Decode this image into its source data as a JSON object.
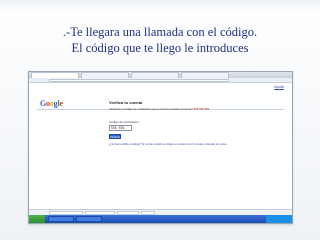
{
  "slide": {
    "caption_line1": ".-Te llegara una llamada con el código.",
    "caption_line2": "El código que te llego le introduces"
  },
  "screenshot": {
    "logo": {
      "g1": "G",
      "o1": "o",
      "o2": "o",
      "g2": "g",
      "l": "l",
      "e": "e"
    },
    "verify_title": "Verifica tu cuenta",
    "verify_body_prefix": "Introduce el código de verificación que te hemos enviado al número ",
    "verify_phone": "555 555 555",
    "code_label": "Código de verificación:",
    "code_value": "555 555",
    "verify_button": "Verificar",
    "help_text": "¿No has recibido el código? Si no has recibido el código en el plazo de 15 minutos, inténtalo de nuevo.",
    "help_link": "Ayuda"
  },
  "colors": {
    "caption": "#1f2f86",
    "google_blue": "#2a5bd7",
    "google_red": "#d8342a",
    "google_yellow": "#e6a400",
    "google_green": "#2c9f45",
    "button_blue": "#2d62c8",
    "taskbar_blue": "#245bc4"
  }
}
